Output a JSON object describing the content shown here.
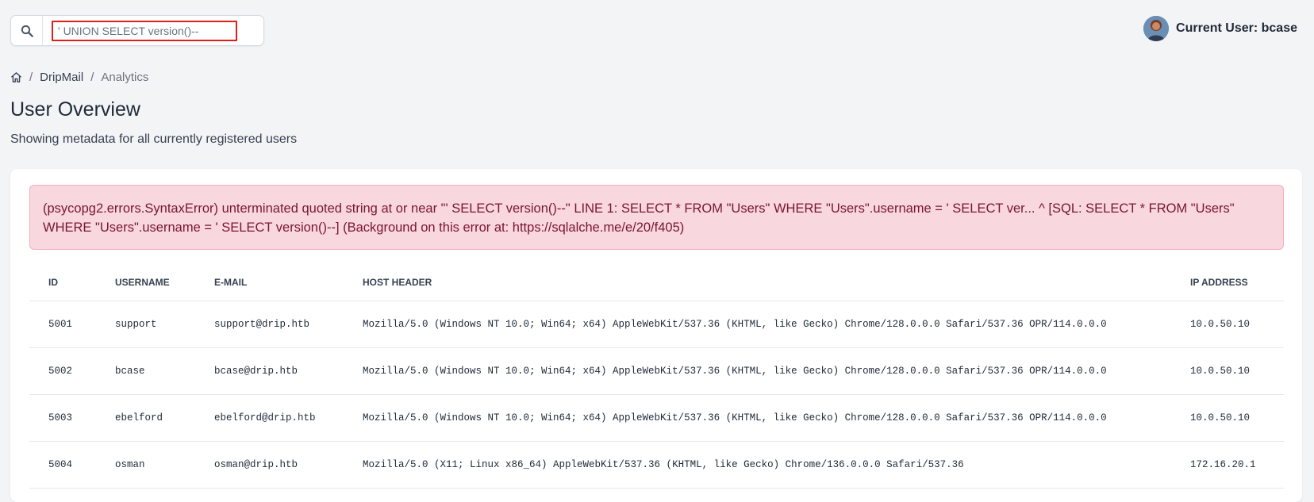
{
  "search": {
    "value": "' UNION SELECT version()--"
  },
  "user": {
    "label": "Current User: bcase"
  },
  "breadcrumb": {
    "items": [
      "DripMail",
      "Analytics"
    ],
    "separator": "/"
  },
  "page": {
    "title": "User Overview",
    "subtitle": "Showing metadata for all currently registered users"
  },
  "error": {
    "message": "(psycopg2.errors.SyntaxError) unterminated quoted string at or near \"' SELECT version()--\" LINE 1: SELECT * FROM \"Users\" WHERE \"Users\".username = ' SELECT ver... ^ [SQL: SELECT * FROM \"Users\" WHERE \"Users\".username = ' SELECT version()--] (Background on this error at: https://sqlalche.me/e/20/f405)"
  },
  "table": {
    "headers": [
      "ID",
      "USERNAME",
      "E-MAIL",
      "HOST HEADER",
      "IP ADDRESS"
    ],
    "rows": [
      [
        "5001",
        "support",
        "support@drip.htb",
        "Mozilla/5.0 (Windows NT 10.0; Win64; x64) AppleWebKit/537.36 (KHTML, like Gecko) Chrome/128.0.0.0 Safari/537.36 OPR/114.0.0.0",
        "10.0.50.10"
      ],
      [
        "5002",
        "bcase",
        "bcase@drip.htb",
        "Mozilla/5.0 (Windows NT 10.0; Win64; x64) AppleWebKit/537.36 (KHTML, like Gecko) Chrome/128.0.0.0 Safari/537.36 OPR/114.0.0.0",
        "10.0.50.10"
      ],
      [
        "5003",
        "ebelford",
        "ebelford@drip.htb",
        "Mozilla/5.0 (Windows NT 10.0; Win64; x64) AppleWebKit/537.36 (KHTML, like Gecko) Chrome/128.0.0.0 Safari/537.36 OPR/114.0.0.0",
        "10.0.50.10"
      ],
      [
        "5004",
        "osman",
        "osman@drip.htb",
        "Mozilla/5.0 (X11; Linux x86_64) AppleWebKit/537.36 (KHTML, like Gecko) Chrome/136.0.0.0 Safari/537.36",
        "172.16.20.1"
      ]
    ]
  },
  "icons": {
    "search": "search-icon",
    "home": "home-icon",
    "avatar": "avatar"
  },
  "colors": {
    "alert_bg": "#f8d7de",
    "alert_text": "#7a1530",
    "input_border": "#e11d1d",
    "page_bg": "#f3f4f6"
  }
}
